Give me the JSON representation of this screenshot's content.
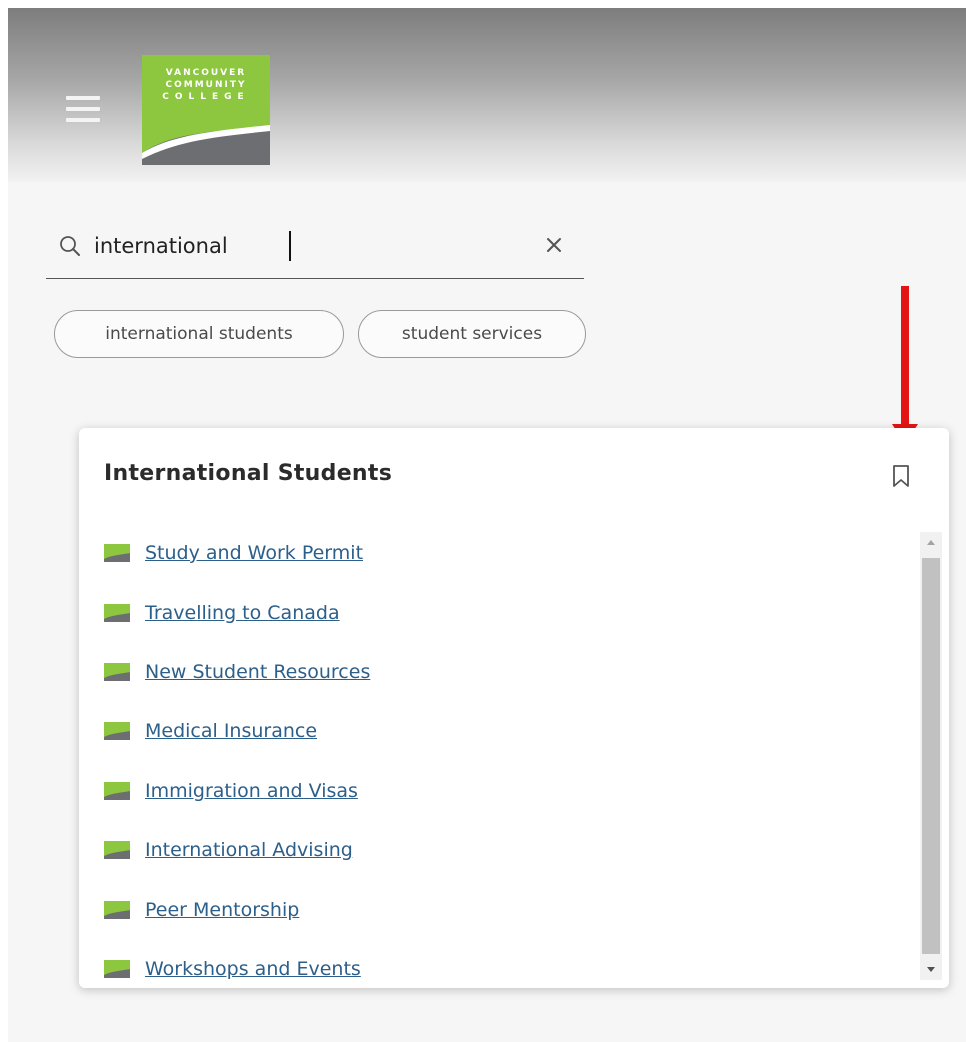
{
  "header": {
    "logo_lines": [
      "VANCOUVER",
      "COMMUNITY",
      "COLLEGE"
    ],
    "colors": {
      "brand_green": "#8dc63f",
      "brand_gray": "#6d6e71"
    },
    "menu_icon": "hamburger-menu-icon"
  },
  "search": {
    "value": "international",
    "icon": "search-icon",
    "clear_icon": "close-icon"
  },
  "suggestions": [
    "international students",
    "student services"
  ],
  "annotation": {
    "icon": "red-arrow-down",
    "color": "#e41414"
  },
  "card": {
    "title": "International Students",
    "bookmark_icon": "bookmark-icon",
    "link_color": "#2c5f8a",
    "links": [
      "Study and Work Permit",
      "Travelling to Canada",
      "New Student Resources",
      "Medical Insurance",
      "Immigration and Visas",
      "International Advising",
      "Peer Mentorship",
      "Workshops and Events"
    ]
  }
}
